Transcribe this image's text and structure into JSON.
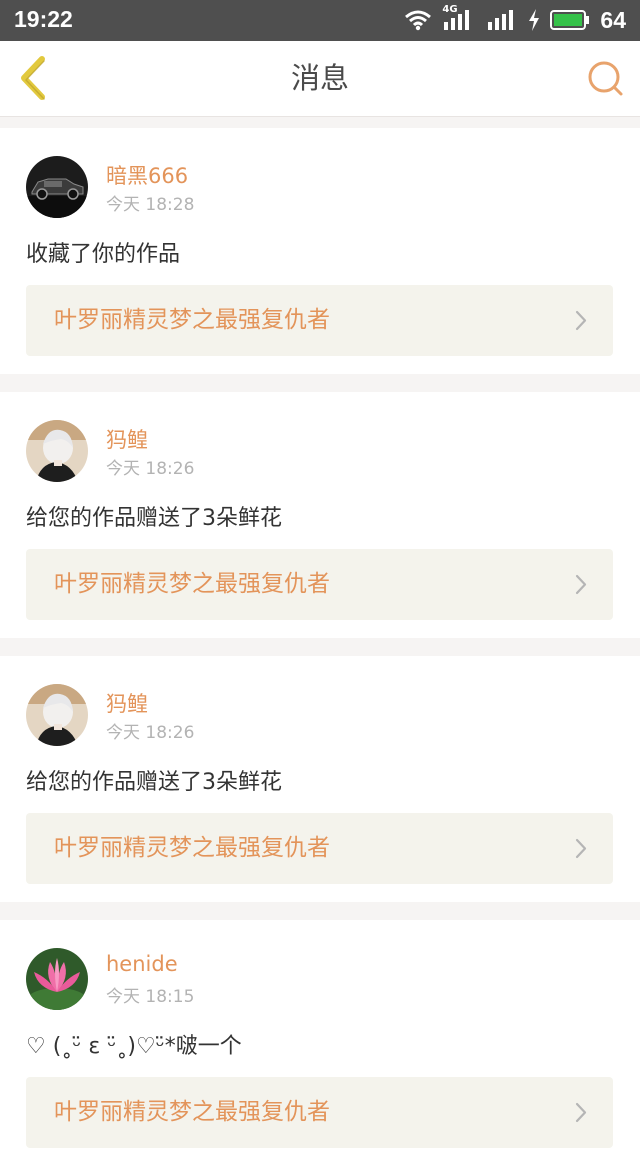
{
  "status_bar": {
    "time": "19:22",
    "signal_label": "4G",
    "battery": "64"
  },
  "header": {
    "title": "消息",
    "back_icon": "chevron-left-icon",
    "search_icon": "search-icon"
  },
  "colors": {
    "accent": "#e3945a",
    "back": "#e2c93e",
    "status_bg": "#4f4f4f",
    "battery": "#36c24a"
  },
  "messages": [
    {
      "username": "暗黑666",
      "time": "今天 18:28",
      "text": "收藏了你的作品",
      "work": "叶罗丽精灵梦之最强复仇者",
      "avatar": "car-avatar"
    },
    {
      "username": "犸鳇",
      "time": "今天 18:26",
      "text": "给您的作品赠送了3朵鲜花",
      "work": "叶罗丽精灵梦之最强复仇者",
      "avatar": "anime-avatar"
    },
    {
      "username": "犸鳇",
      "time": "今天 18:26",
      "text": "给您的作品赠送了3朵鲜花",
      "work": "叶罗丽精灵梦之最强复仇者",
      "avatar": "anime-avatar"
    },
    {
      "username": "henide",
      "time": "今天 18:15",
      "text": "♡ (˳ᵕ̈ ε ᵕ̈˳)♡ᵕ̈*啵一个",
      "work": "叶罗丽精灵梦之最强复仇者",
      "avatar": "lotus-avatar"
    }
  ]
}
